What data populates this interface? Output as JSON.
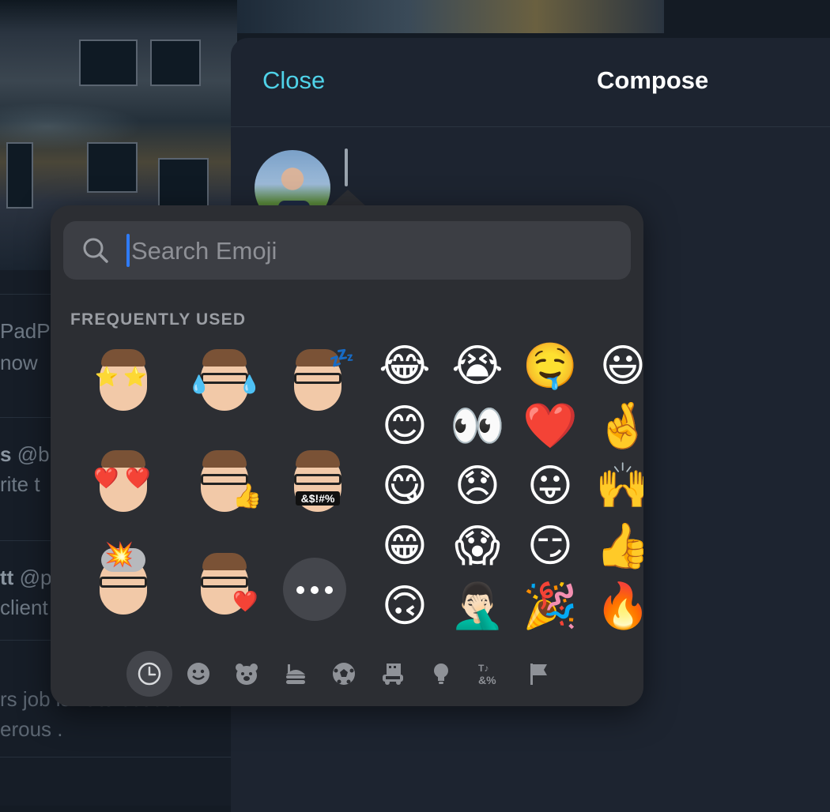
{
  "background_timeline": {
    "rows": [
      {
        "handle": "PadPr",
        "text": "now"
      },
      {
        "name": "s",
        "handle": "@b",
        "text": "rite t"
      },
      {
        "name": "tt",
        "handle": "@p",
        "text": "client"
      },
      {
        "text": "rs job isn't to scout a r",
        "text2": "erous ."
      }
    ]
  },
  "compose": {
    "close_label": "Close",
    "title": "Compose"
  },
  "emoji_picker": {
    "search_placeholder": "Search Emoji",
    "section_title": "FREQUENTLY USED",
    "memoji": [
      {
        "name": "memoji-star-struck"
      },
      {
        "name": "memoji-tears-of-joy"
      },
      {
        "name": "memoji-sleeping"
      },
      {
        "name": "memoji-heart-eyes"
      },
      {
        "name": "memoji-thumbs-up"
      },
      {
        "name": "memoji-cursing",
        "symbols": "&$!#%"
      },
      {
        "name": "memoji-mind-blown"
      },
      {
        "name": "memoji-kiss-heart"
      }
    ],
    "emoji_rows": [
      [
        "😂",
        "😭",
        "🤤",
        "😃"
      ],
      [
        "😊",
        "👀",
        "❤️",
        "🤞"
      ],
      [
        "😋",
        "😞",
        "😛",
        "🙌"
      ],
      [
        "😁",
        "😱",
        "😏",
        "👍"
      ],
      [
        "🙃",
        "🤦🏻‍♂️",
        "🎉",
        "🔥"
      ]
    ],
    "categories": [
      {
        "icon": "clock-icon",
        "active": true
      },
      {
        "icon": "smiley-icon",
        "active": false
      },
      {
        "icon": "bear-icon",
        "active": false
      },
      {
        "icon": "food-icon",
        "active": false
      },
      {
        "icon": "soccer-ball-icon",
        "active": false
      },
      {
        "icon": "car-building-icon",
        "active": false
      },
      {
        "icon": "lightbulb-icon",
        "active": false
      },
      {
        "icon": "symbols-icon",
        "active": false
      },
      {
        "icon": "flag-icon",
        "active": false
      }
    ],
    "symbols_icon_text": "&%"
  },
  "colors": {
    "accent": "#4fd2e8",
    "caret": "#2f7bf6",
    "picker_bg": "#2c2e33",
    "sheet_bg": "#1d2430"
  }
}
